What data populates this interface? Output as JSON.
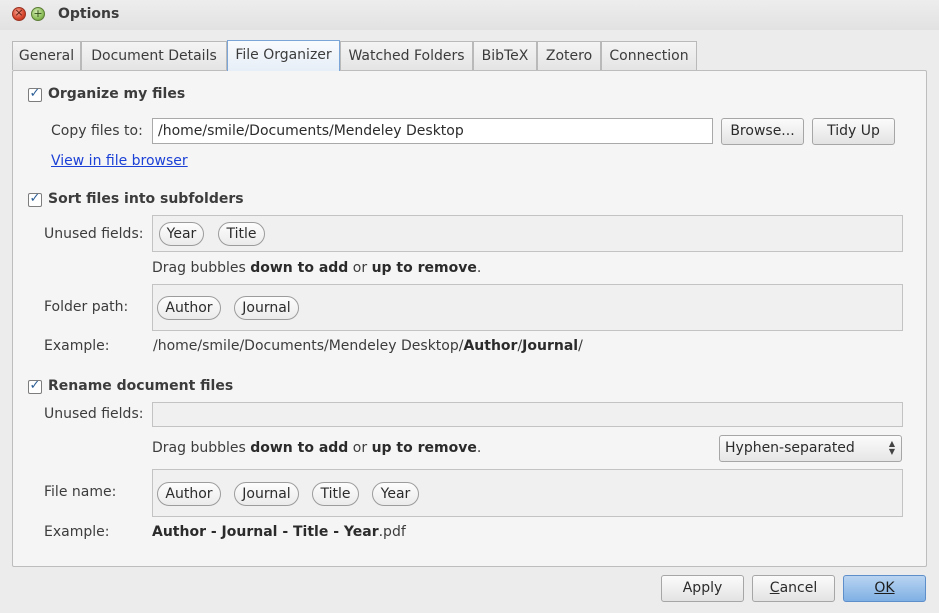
{
  "window": {
    "title": "Options"
  },
  "tabs": [
    {
      "label": "General"
    },
    {
      "label": "Document Details"
    },
    {
      "label": "File Organizer"
    },
    {
      "label": "Watched Folders"
    },
    {
      "label": "BibTeX"
    },
    {
      "label": "Zotero"
    },
    {
      "label": "Connection"
    }
  ],
  "active_tab": "File Organizer",
  "organize": {
    "label": "Organize my files",
    "checked": true,
    "copy_label": "Copy files to:",
    "copy_path": "/home/smile/Documents/Mendeley Desktop",
    "browse_label": "Browse...",
    "tidy_label": "Tidy Up",
    "view_link": "View in file browser"
  },
  "sort": {
    "label": "Sort files into subfolders",
    "checked": true,
    "unused_label": "Unused fields:",
    "unused_fields": [
      "Year",
      "Title"
    ],
    "hint_pre": "Drag bubbles ",
    "hint_add": "down to add",
    "hint_mid": " or ",
    "hint_remove": "up to remove",
    "hint_post": ".",
    "folder_label": "Folder path:",
    "folder_fields": [
      "Author",
      "Journal"
    ],
    "example_label": "Example:",
    "example_prefix": "/home/smile/Documents/Mendeley Desktop/",
    "example_author": "Author",
    "example_sep": "/",
    "example_journal": "Journal",
    "example_suffix": "/"
  },
  "rename": {
    "label": "Rename document files",
    "checked": true,
    "unused_label": "Unused fields:",
    "hint_pre": "Drag bubbles ",
    "hint_add": "down to add",
    "hint_mid": " or ",
    "hint_remove": "up to remove",
    "hint_post": ".",
    "separator_value": "Hyphen-separated",
    "filename_label": "File name:",
    "filename_fields": [
      "Author",
      "Journal",
      "Title",
      "Year"
    ],
    "example_label": "Example:",
    "example_name": "Author - Journal - Title - Year",
    "example_ext": ".pdf"
  },
  "footer": {
    "apply_label": "Apply",
    "cancel_first": "C",
    "cancel_rest": "ancel",
    "ok_label": "OK"
  },
  "icons": {
    "close": "close-icon",
    "maximize": "maximize-icon",
    "checkbox": "checkmark-icon",
    "dropdown": "updown-arrows-icon"
  }
}
